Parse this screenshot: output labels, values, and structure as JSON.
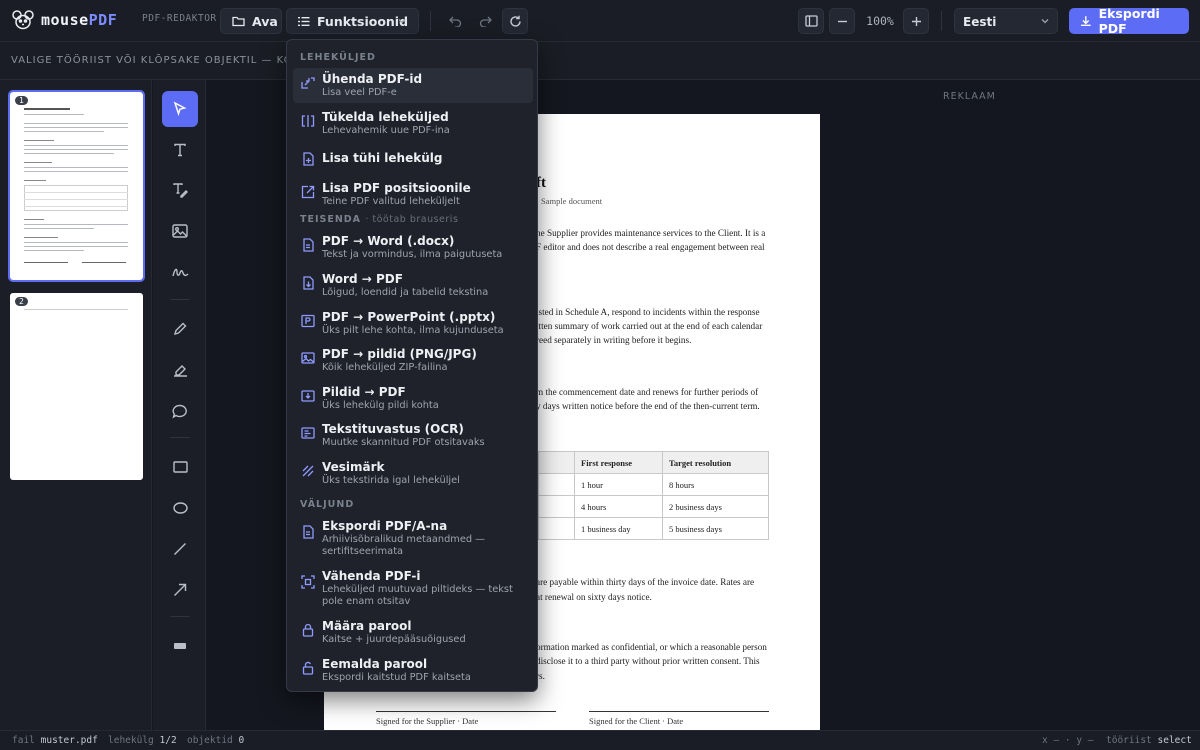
{
  "app": {
    "logo_main": "mouse",
    "logo_accent": "PDF",
    "subtitle": "PDF-REDAKTOR"
  },
  "toolbar": {
    "open_label": "Ava",
    "functions_label": "Funktsioonid",
    "zoom": "100%",
    "language": "Eesti",
    "export_label": "Ekspordi PDF"
  },
  "context_hint": "VALIGE TÖÖRIIST VÕI KLÕPSAKE OBJEKTIL — KONTEKSTIVALIKUD",
  "pages": {
    "items": [
      {
        "number": "1",
        "selected": true
      },
      {
        "number": "2",
        "selected": false
      }
    ]
  },
  "tools": [
    {
      "icon": "pointer-icon",
      "active": true
    },
    {
      "icon": "text-icon",
      "active": false
    },
    {
      "icon": "text-edit-icon",
      "active": false
    },
    {
      "icon": "image-icon",
      "active": false
    },
    {
      "icon": "signature-icon",
      "active": false
    },
    {
      "icon": "pen-icon",
      "active": false
    },
    {
      "icon": "highlighter-icon",
      "active": false
    },
    {
      "icon": "comment-icon",
      "active": false
    },
    {
      "icon": "rectangle-icon",
      "active": false
    },
    {
      "icon": "ellipse-icon",
      "active": false
    },
    {
      "icon": "line-icon",
      "active": false
    },
    {
      "icon": "arrow-icon",
      "active": false
    },
    {
      "icon": "redact-icon",
      "active": false
    }
  ],
  "canvas": {
    "ad_label": "REKLAAM"
  },
  "document": {
    "title_fragment": "ft",
    "subtitle_fragment": "· Sample document",
    "para1": [
      "he Supplier provides maintenance services to the Client. It is a",
      "F editor and does not describe a real engagement between real"
    ],
    "para2": [
      "isted in Schedule A, respond to incidents within the response",
      "itten summary of work carried out at the end of each calendar",
      "reed separately in writing before it begins."
    ],
    "para3": [
      "m the commencement date and renews for further periods of",
      "y days written notice before the end of the then-current term."
    ],
    "table": {
      "headers": [
        "First response",
        "Target resolution"
      ],
      "rows": [
        [
          "1 hour",
          "8 hours"
        ],
        [
          "4 hours",
          "2 business days"
        ],
        [
          "1 business day",
          "5 business days"
        ]
      ]
    },
    "para4": [
      "are payable within thirty days of the invoice date. Rates are",
      "at renewal on sixty days notice."
    ],
    "para5": [
      "ormation marked as confidential, or which a reasonable person",
      "disclose it to a third party without prior written consent. This",
      "rs."
    ],
    "sig_supplier": "Signed for the Supplier · Date",
    "sig_client": "Signed for the Client · Date"
  },
  "menu": {
    "sections": [
      {
        "title": "LEHEKÜLJED",
        "note": "",
        "items": [
          {
            "label": "Ühenda PDF-id",
            "desc": "Lisa veel PDF-e",
            "icon": "merge-icon",
            "highlighted": true
          },
          {
            "label": "Tükelda leheküljed",
            "desc": "Lehevahemik uue PDF-ina",
            "icon": "split-icon",
            "highlighted": false
          },
          {
            "label": "Lisa tühi lehekülg",
            "desc": "",
            "icon": "add-page-icon",
            "highlighted": false
          },
          {
            "label": "Lisa PDF positsioonile",
            "desc": "Teine PDF valitud leheküljelt",
            "icon": "insert-pdf-icon",
            "highlighted": false
          }
        ]
      },
      {
        "title": "TEISENDA",
        "note": "· töötab brauseris",
        "items": [
          {
            "label": "PDF → Word (.docx)",
            "desc": "Tekst ja vormindus, ilma paigutuseta",
            "icon": "word-icon",
            "highlighted": false
          },
          {
            "label": "Word → PDF",
            "desc": "Lõigud, loendid ja tabelid tekstina",
            "icon": "to-pdf-icon",
            "highlighted": false
          },
          {
            "label": "PDF → PowerPoint (.pptx)",
            "desc": "Üks pilt lehe kohta, ilma kujunduseta",
            "icon": "powerpoint-icon",
            "highlighted": false
          },
          {
            "label": "PDF → pildid (PNG/JPG)",
            "desc": "Kõik leheküljed ZIP-failina",
            "icon": "image-export-icon",
            "highlighted": false
          },
          {
            "label": "Pildid → PDF",
            "desc": "Üks lehekülg pildi kohta",
            "icon": "image-import-icon",
            "highlighted": false
          },
          {
            "label": "Tekstituvastus (OCR)",
            "desc": "Muutke skannitud PDF otsitavaks",
            "icon": "ocr-icon",
            "highlighted": false
          },
          {
            "label": "Vesimärk",
            "desc": "Üks tekstirida igal leheküljel",
            "icon": "watermark-icon",
            "highlighted": false
          }
        ]
      },
      {
        "title": "VÄLJUND",
        "note": "",
        "items": [
          {
            "label": "Ekspordi PDF/A-na",
            "desc": "Arhiivisõbralikud metaandmed — sertifitseerimata",
            "icon": "pdfa-icon",
            "highlighted": false
          },
          {
            "label": "Vähenda PDF-i",
            "desc": "Leheküljed muutuvad piltideks — tekst pole enam otsitav",
            "icon": "compress-icon",
            "highlighted": false
          },
          {
            "label": "Määra parool",
            "desc": "Kaitse + juurdepääsuõigused",
            "icon": "lock-icon",
            "highlighted": false
          },
          {
            "label": "Eemalda parool",
            "desc": "Ekspordi kaitstud PDF kaitseta",
            "icon": "unlock-icon",
            "highlighted": false
          }
        ]
      }
    ]
  },
  "status": {
    "file_label": "fail",
    "file_value": "muster.pdf",
    "page_label": "lehekülg",
    "page_value": "1/2",
    "objects_label": "objektid",
    "objects_value": "0",
    "coords": "x — · y —",
    "tool_label": "tööriist",
    "tool_value": "select"
  }
}
